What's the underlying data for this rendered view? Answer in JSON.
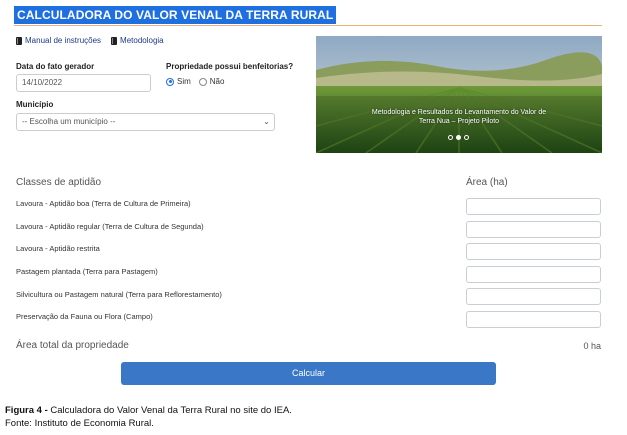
{
  "app": {
    "title": "CALCULADORA DO VALOR VENAL DA TERRA RURAL"
  },
  "links": [
    {
      "label": "Manual de instruções",
      "icon": "book-icon"
    },
    {
      "label": "Metodologia",
      "icon": "book-icon"
    }
  ],
  "form": {
    "date_label": "Data do fato gerador",
    "date_value": "14/10/2022",
    "improvements_label": "Propriedade possui benfeitorias?",
    "options": [
      {
        "label": "Sim",
        "selected": true
      },
      {
        "label": "Não",
        "selected": false
      }
    ],
    "municipality_label": "Município",
    "municipality_value": "-- Escolha um município --"
  },
  "carousel": {
    "caption_line1": "Metodologia e Resultados do Levantamento do Valor de",
    "caption_line2": "Terra Nua – Projeto Piloto",
    "slide_count": 3,
    "active_slide": 2
  },
  "table": {
    "header_classes": "Classes de aptidão",
    "header_area": "Área (ha)",
    "rows": [
      {
        "label": "Lavoura - Aptidão boa (Terra de Cultura de Primeira)",
        "value": ""
      },
      {
        "label": "Lavoura - Aptidão regular (Terra de Cultura de Segunda)",
        "value": ""
      },
      {
        "label": "Lavoura - Aptidão restrita",
        "value": ""
      },
      {
        "label": "Pastagem plantada (Terra para Pastagem)",
        "value": ""
      },
      {
        "label": "Silvicultura ou Pastagem natural (Terra para Reflorestamento)",
        "value": ""
      },
      {
        "label": "Preservação da Fauna ou Flora (Campo)",
        "value": ""
      }
    ],
    "total_label": "Área total da propriedade",
    "total_value": "0 ha"
  },
  "actions": {
    "calculate_label": "Calcular"
  },
  "caption": {
    "figure_label": "Figura 4 -",
    "figure_text": "Calculadora do Valor Venal da Terra Rural no site do IEA.",
    "source": "Fonte: Instituto de Economia Rural."
  },
  "colors": {
    "accent": "#1e6fe0",
    "button": "#3a78c7",
    "rule": "#e7b27a"
  }
}
